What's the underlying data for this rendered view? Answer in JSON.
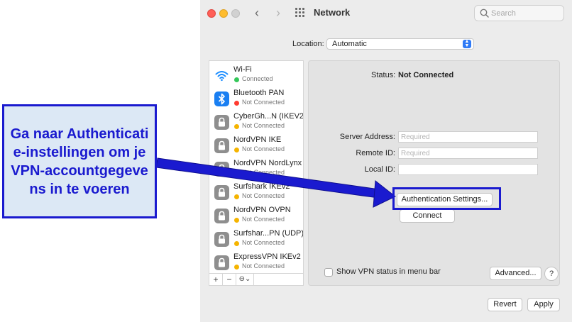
{
  "window": {
    "title": "Network",
    "search_placeholder": "Search"
  },
  "location": {
    "label": "Location:",
    "value": "Automatic"
  },
  "services": [
    {
      "name": "Wi-Fi",
      "status": "Connected",
      "status_color": "#34c759",
      "icon": "wifi-icon"
    },
    {
      "name": "Bluetooth PAN",
      "status": "Not Connected",
      "status_color": "#ff3b30",
      "icon": "bluetooth-icon"
    },
    {
      "name": "CyberGh...N (IKEV2)",
      "status": "Not Connected",
      "status_color": "#f5b400",
      "icon": "lock-icon"
    },
    {
      "name": "NordVPN IKE",
      "status": "Not Connected",
      "status_color": "#f5b400",
      "icon": "lock-icon"
    },
    {
      "name": "NordVPN NordLynx",
      "status": "Not Connected",
      "status_color": "#f5b400",
      "icon": "lock-icon"
    },
    {
      "name": "Surfshark IKEv2",
      "status": "Not Connected",
      "status_color": "#f5b400",
      "icon": "lock-icon"
    },
    {
      "name": "NordVPN OVPN",
      "status": "Not Connected",
      "status_color": "#f5b400",
      "icon": "lock-icon"
    },
    {
      "name": "Surfshar...PN (UDP)",
      "status": "Not Connected",
      "status_color": "#f5b400",
      "icon": "lock-icon"
    },
    {
      "name": "ExpressVPN IKEv2",
      "status": "Not Connected",
      "status_color": "#f5b400",
      "icon": "lock-icon"
    }
  ],
  "sidebar_tools": {
    "add": "+",
    "remove": "−",
    "more": "⊖⌄"
  },
  "detail": {
    "status_label": "Status:",
    "status_value": "Not Connected",
    "server_address_label": "Server Address:",
    "server_address_placeholder": "Required",
    "remote_id_label": "Remote ID:",
    "remote_id_placeholder": "Required",
    "local_id_label": "Local ID:",
    "local_id_value": "",
    "auth_button": "Authentication Settings...",
    "connect_button": "Connect",
    "show_vpn_label": "Show VPN status in menu bar",
    "advanced_button": "Advanced...",
    "help_button": "?"
  },
  "footer": {
    "revert_button": "Revert",
    "apply_button": "Apply"
  },
  "callout": {
    "text": "Ga naar Authenticatie-instellingen om je VPN-accountgegevens in te voeren",
    "color": "#1a1acf"
  }
}
